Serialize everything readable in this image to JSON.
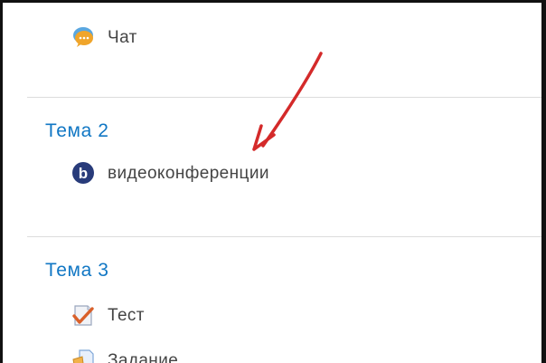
{
  "sections": [
    {
      "activities": [
        {
          "label": "Чат",
          "icon": "chat-icon"
        }
      ]
    },
    {
      "title": "Тема 2",
      "activities": [
        {
          "label": "видеоконференции",
          "icon": "bigbluebutton-icon"
        }
      ]
    },
    {
      "title": "Тема 3",
      "activities": [
        {
          "label": "Тест",
          "icon": "quiz-icon"
        },
        {
          "label": "Задание",
          "icon": "assignment-icon"
        }
      ]
    }
  ],
  "colors": {
    "section_title": "#1177c4",
    "activity_text": "#444444",
    "divider": "#dcdcdc",
    "annotation_arrow": "#d42a2a"
  }
}
